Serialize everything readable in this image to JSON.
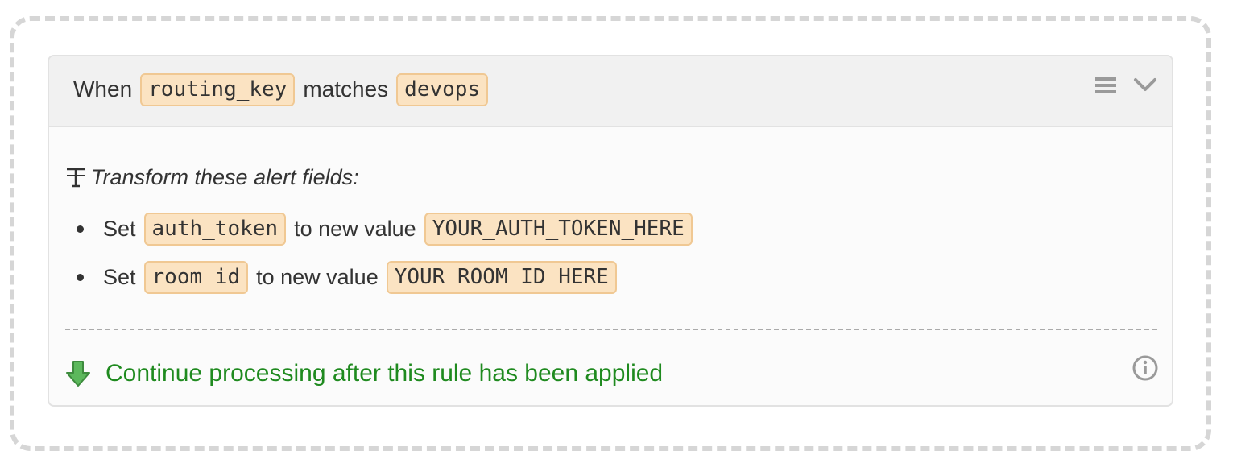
{
  "rule": {
    "condition": {
      "when_label": "When",
      "field": "routing_key",
      "operator_label": "matches",
      "value": "devops"
    },
    "header_icons": [
      "hamburger-icon",
      "chevron-down-icon"
    ],
    "transform": {
      "icon": "text-format-icon",
      "heading": "Transform these alert fields:",
      "items": [
        {
          "set_label": "Set",
          "field": "auth_token",
          "middle_label": "to new value",
          "value": "YOUR_AUTH_TOKEN_HERE"
        },
        {
          "set_label": "Set",
          "field": "room_id",
          "middle_label": "to new value",
          "value": "YOUR_ROOM_ID_HERE"
        }
      ]
    },
    "footer": {
      "icon": "arrow-down-icon",
      "text": "Continue processing after this rule has been applied",
      "info_icon": "info-icon"
    }
  },
  "colors": {
    "chip_bg": "#fbe3c2",
    "chip_border": "#f0c893",
    "continue_text": "#1f8a1f",
    "arrow_fill": "#5cb85c"
  }
}
